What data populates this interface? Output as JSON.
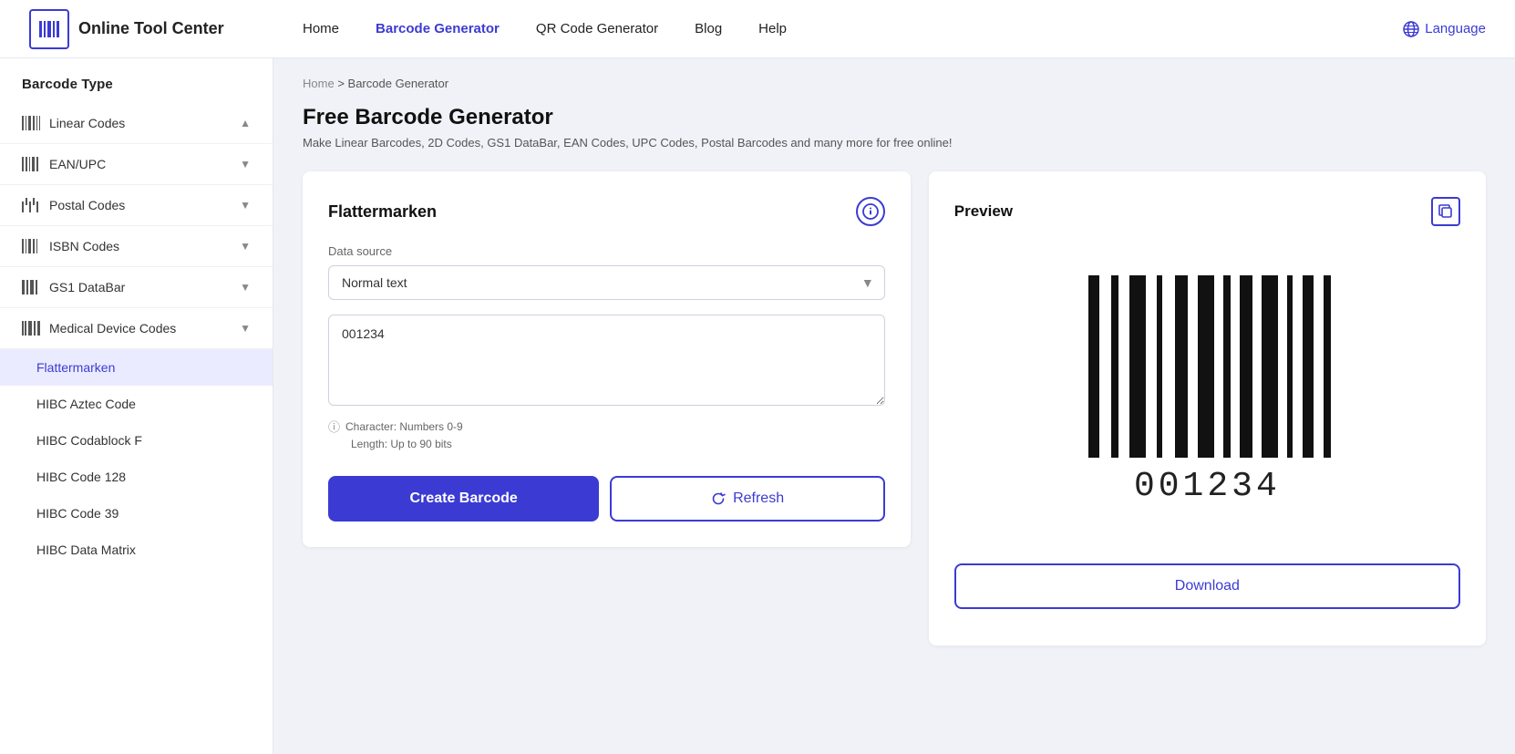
{
  "header": {
    "logo_text": "Online Tool Center",
    "nav_items": [
      {
        "label": "Home",
        "active": false
      },
      {
        "label": "Barcode Generator",
        "active": true
      },
      {
        "label": "QR Code Generator",
        "active": false
      },
      {
        "label": "Blog",
        "active": false
      },
      {
        "label": "Help",
        "active": false
      }
    ],
    "language_label": "Language"
  },
  "sidebar": {
    "section_title": "Barcode Type",
    "categories": [
      {
        "label": "Linear Codes",
        "icon": "barcode",
        "expanded": true
      },
      {
        "label": "EAN/UPC",
        "icon": "barcode",
        "expanded": false
      },
      {
        "label": "Postal Codes",
        "icon": "postal",
        "expanded": false
      },
      {
        "label": "ISBN Codes",
        "icon": "barcode",
        "expanded": false
      },
      {
        "label": "GS1 DataBar",
        "icon": "barcode",
        "expanded": false
      },
      {
        "label": "Medical Device Codes",
        "icon": "barcode",
        "expanded": false
      }
    ],
    "items": [
      {
        "label": "Flattermarken",
        "active": true
      },
      {
        "label": "HIBC Aztec Code",
        "active": false
      },
      {
        "label": "HIBC Codablock F",
        "active": false
      },
      {
        "label": "HIBC Code 128",
        "active": false
      },
      {
        "label": "HIBC Code 39",
        "active": false
      },
      {
        "label": "HIBC Data Matrix",
        "active": false
      }
    ]
  },
  "breadcrumb": {
    "home": "Home",
    "separator": ">",
    "current": "Barcode Generator"
  },
  "main": {
    "page_title": "Free Barcode Generator",
    "page_subtitle": "Make Linear Barcodes, 2D Codes, GS1 DataBar, EAN Codes, UPC Codes, Postal Barcodes and many more for free online!",
    "left_panel": {
      "title": "Flattermarken",
      "data_source_label": "Data source",
      "select_options": [
        {
          "value": "normal_text",
          "label": "Normal text"
        }
      ],
      "select_value": "Normal text",
      "textarea_value": "001234",
      "char_info_line1": "Character: Numbers 0-9",
      "char_info_line2": "Length: Up to 90 bits",
      "btn_create": "Create Barcode",
      "btn_refresh": "Refresh"
    },
    "right_panel": {
      "title": "Preview",
      "barcode_value": "001234",
      "btn_download": "Download"
    }
  }
}
